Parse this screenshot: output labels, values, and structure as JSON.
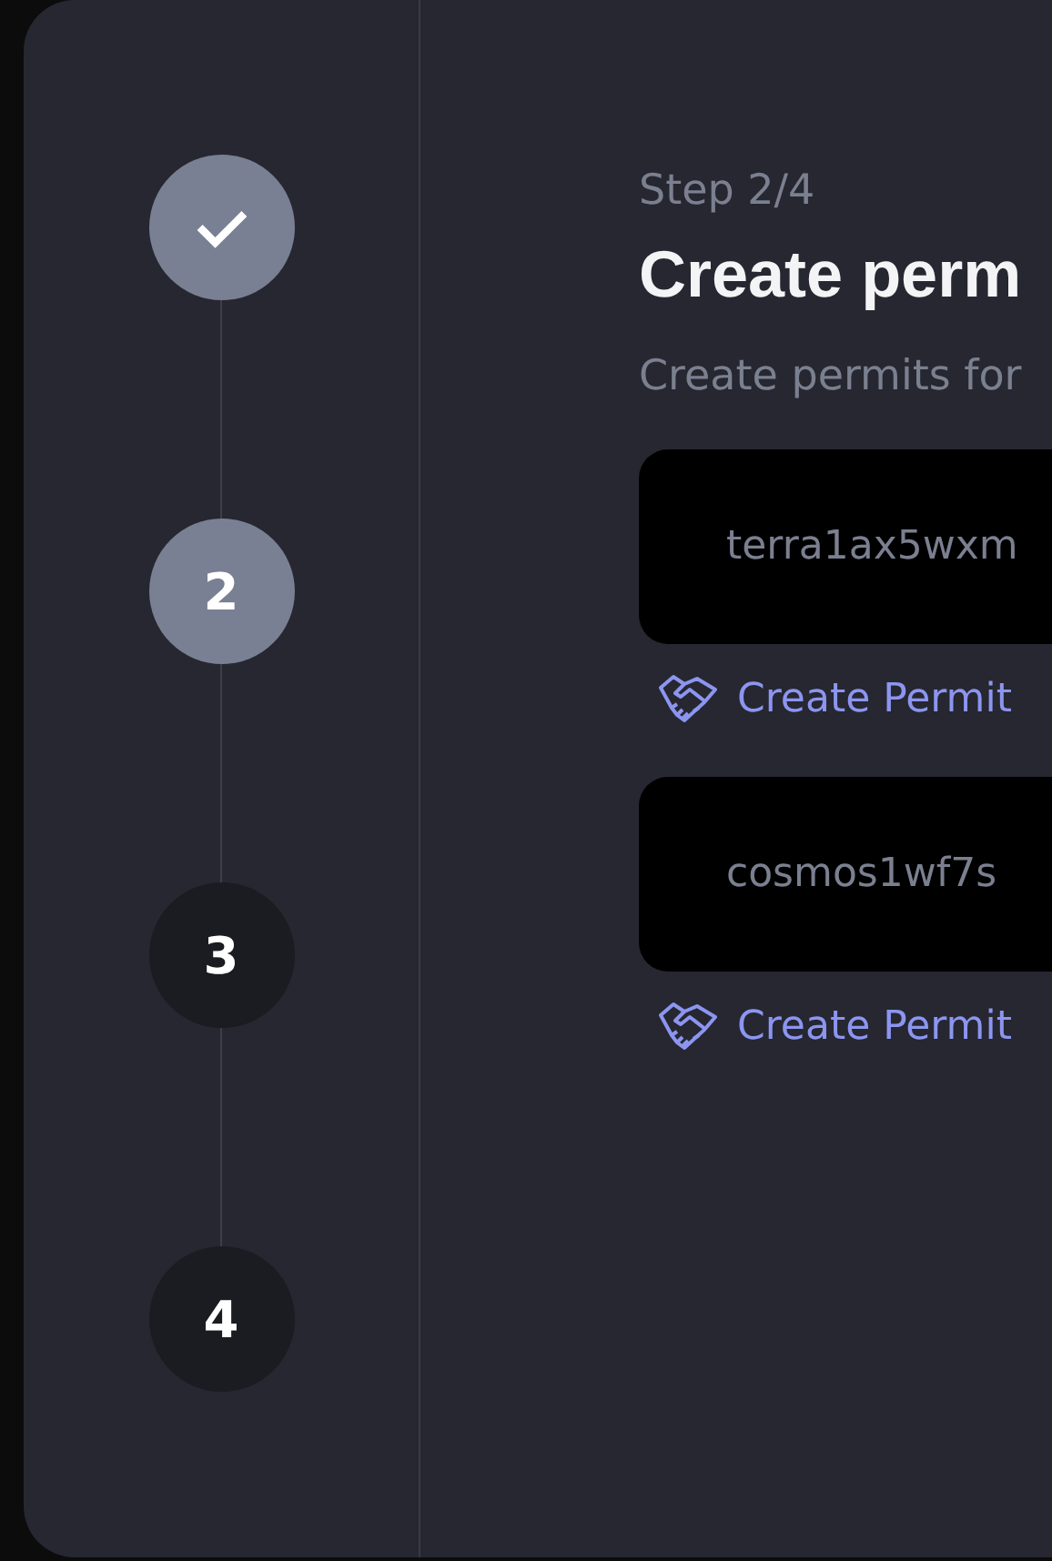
{
  "steps": [
    {
      "completed": true,
      "selected": false
    },
    {
      "label": "2",
      "completed": false,
      "selected": true
    },
    {
      "label": "3",
      "completed": false,
      "selected": false
    },
    {
      "label": "4",
      "completed": false,
      "selected": false
    }
  ],
  "content": {
    "step_counter": "Step 2/4",
    "title": "Create perm",
    "subtitle": "Create permits for",
    "addresses": [
      {
        "address": "terra1ax5wxm",
        "action": "Create Permit"
      },
      {
        "address": "cosmos1wf7s",
        "action": "Create Permit"
      }
    ]
  }
}
